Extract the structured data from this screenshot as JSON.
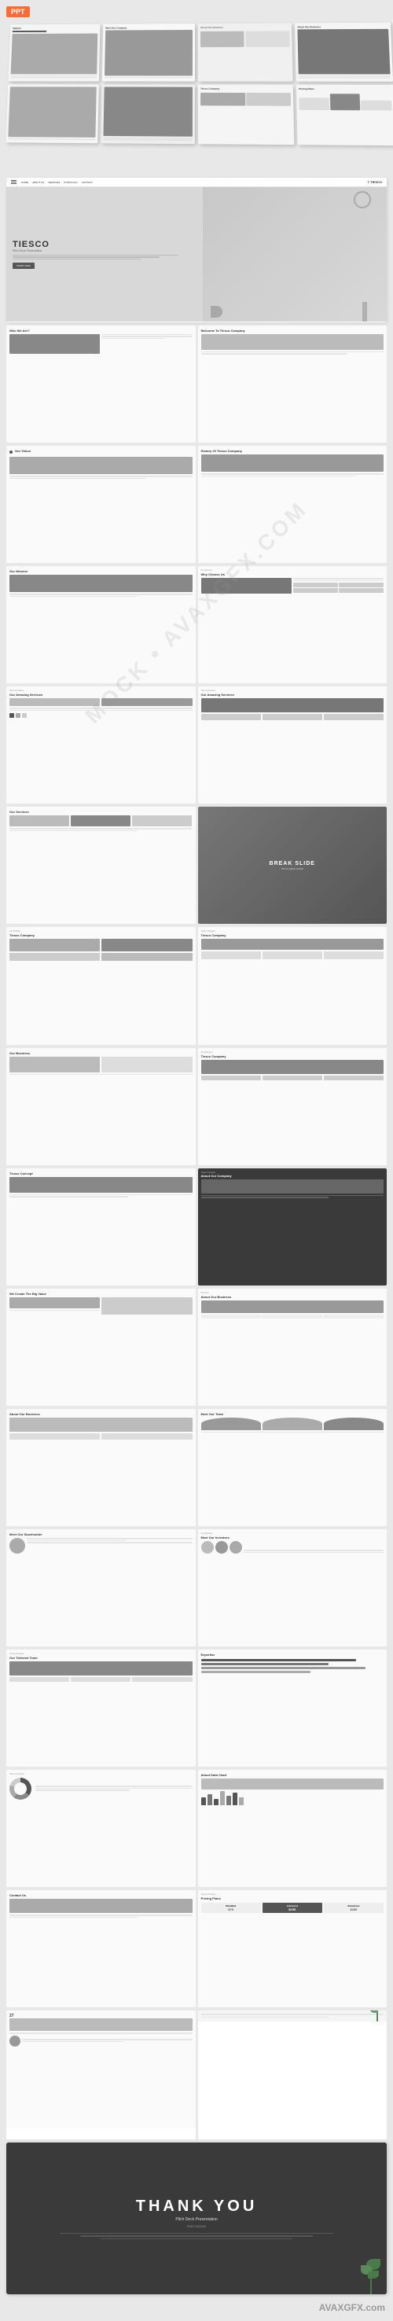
{
  "badge": {
    "label": "PPT"
  },
  "watermark": "MOCK • AVAXGFX.COM • WATERMARK",
  "avaxgfx": "AVAXGFX.com",
  "hero": {
    "nav": {
      "items": [
        "HOME",
        "ABOUT US",
        "SERVICES",
        "PORTFOLIO",
        "CONTACT"
      ],
      "logo": "T TIESCO"
    },
    "title": "TIESCO",
    "subtitle": "Pitch Deck Presentation",
    "body_text": "Lorem ipsum dolor sit amet, consectetur adipiscing elit. Lorem tu quis tell print.",
    "cta": "START NOW"
  },
  "slides": {
    "who_we_are": "Who We Are?",
    "our_vision": "Our Vision",
    "our_mission": "Our Mission",
    "why_choose": "Why Choose Us",
    "amazing_services": "Our Amazing Services",
    "our_services": "Our Services",
    "break_slide": {
      "title": "BREAK SLIDE",
      "subtitle": "PITCH DECK SLIDE"
    },
    "tiesco_company": "Tiesco Company",
    "tiesco_concept": "Tiesco Concept",
    "about_company": "About Our Company",
    "big_value": "We Create The Big Value",
    "about_business": "About Our Business",
    "meet_team": "Meet Our Team",
    "our_investors": "Meet Our Investors",
    "talented_team": "Our Talented Team",
    "data_chart": "About Data Chart",
    "pricing": "Pricing Plans",
    "thank_you": {
      "title": "THANK YOU",
      "subtitle": "Pitch Deck Presentation",
      "name": "POST XXXXXX",
      "body": "TIESCO is a clean & simple template design. Edipot enim, tei quo la weil plom. Etiam purus quam, eleifend at, condimentum sed. Lorem ipsum quela werde."
    },
    "pricing_plans": {
      "standard": {
        "label": "Standard",
        "price": "$79"
      },
      "advanced": {
        "label": "Advanced",
        "price": "$159"
      },
      "enterprise": {
        "label": "Enterprise",
        "price": "$199"
      }
    }
  }
}
